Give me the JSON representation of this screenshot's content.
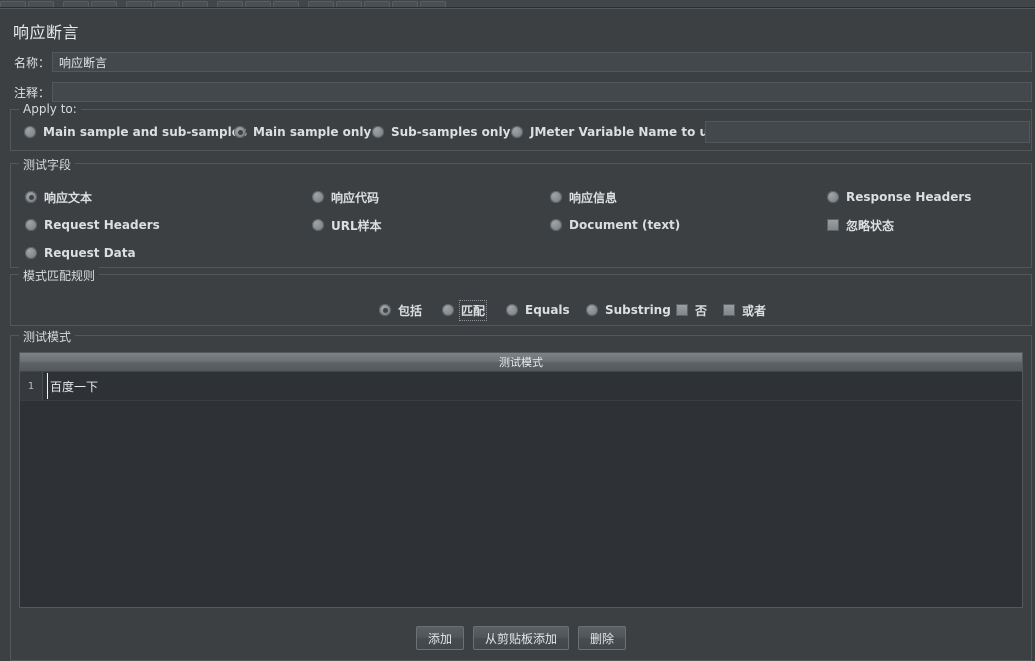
{
  "toolbar": {
    "button_count": 13
  },
  "panel": {
    "title": "响应断言",
    "name_label": "名称：",
    "name_value": "响应断言",
    "comment_label": "注释：",
    "comment_value": ""
  },
  "apply_to": {
    "group_title": "Apply to:",
    "options": [
      {
        "label": "Main sample and sub-samples",
        "selected": false
      },
      {
        "label": "Main sample only",
        "selected": true
      },
      {
        "label": "Sub-samples only",
        "selected": false
      },
      {
        "label": "JMeter Variable Name to use",
        "selected": false
      }
    ],
    "variable_value": ""
  },
  "test_field": {
    "group_title": "测试字段",
    "options": [
      {
        "label": "响应文本",
        "selected": true,
        "type": "radio"
      },
      {
        "label": "响应代码",
        "selected": false,
        "type": "radio"
      },
      {
        "label": "响应信息",
        "selected": false,
        "type": "radio"
      },
      {
        "label": "Response Headers",
        "selected": false,
        "type": "radio"
      },
      {
        "label": "Request Headers",
        "selected": false,
        "type": "radio"
      },
      {
        "label": "URL样本",
        "selected": false,
        "type": "radio"
      },
      {
        "label": "Document (text)",
        "selected": false,
        "type": "radio"
      },
      {
        "label": "忽略状态",
        "selected": false,
        "type": "checkbox"
      },
      {
        "label": "Request Data",
        "selected": false,
        "type": "radio"
      }
    ]
  },
  "pattern_rules": {
    "group_title": "模式匹配规则",
    "options": [
      {
        "label": "包括",
        "selected": true,
        "type": "radio",
        "focused": false
      },
      {
        "label": "匹配",
        "selected": false,
        "type": "radio",
        "focused": true
      },
      {
        "label": "Equals",
        "selected": false,
        "type": "radio",
        "focused": false
      },
      {
        "label": "Substring",
        "selected": false,
        "type": "radio",
        "focused": false
      },
      {
        "label": "否",
        "selected": false,
        "type": "checkbox",
        "focused": false
      },
      {
        "label": "或者",
        "selected": false,
        "type": "checkbox",
        "focused": false
      }
    ]
  },
  "test_patterns": {
    "group_title": "测试模式",
    "column_header": "测试模式",
    "rows": [
      {
        "num": "1",
        "value": "百度一下"
      }
    ],
    "buttons": [
      {
        "label": "添加"
      },
      {
        "label": "从剪贴板添加"
      },
      {
        "label": "删除"
      }
    ]
  }
}
